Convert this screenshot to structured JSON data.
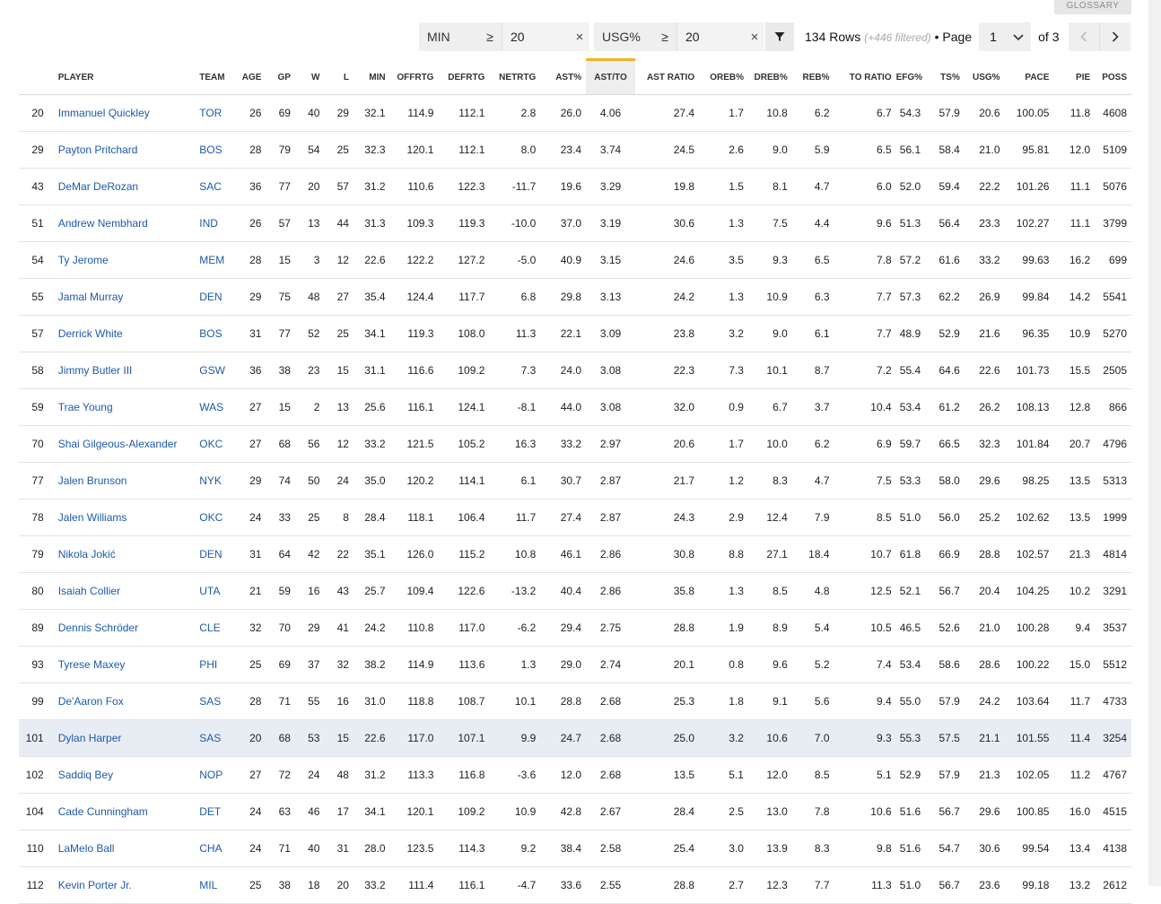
{
  "glossary_label": "GLOSSARY",
  "filters": [
    {
      "stat": "MIN",
      "op": "≥",
      "value": "20"
    },
    {
      "stat": "USG%",
      "op": "≥",
      "value": "20"
    }
  ],
  "rows_info": {
    "rows": "134 Rows",
    "filtered": "(+446 filtered)",
    "page_label": "• Page",
    "page": "1",
    "of_pages": "of 3"
  },
  "columns": [
    "",
    "PLAYER",
    "TEAM",
    "AGE",
    "GP",
    "W",
    "L",
    "MIN",
    "OFFRTG",
    "DEFRTG",
    "NETRTG",
    "AST%",
    "AST/TO",
    "AST RATIO",
    "OREB%",
    "DREB%",
    "REB%",
    "TO RATIO",
    "EFG%",
    "TS%",
    "USG%",
    "PACE",
    "PIE",
    "POSS"
  ],
  "rows": [
    [
      "20",
      "Immanuel Quickley",
      "TOR",
      "26",
      "69",
      "40",
      "29",
      "32.1",
      "114.9",
      "112.1",
      "2.8",
      "26.0",
      "4.06",
      "27.4",
      "1.7",
      "10.8",
      "6.2",
      "6.7",
      "54.3",
      "57.9",
      "20.6",
      "100.05",
      "11.8",
      "4608"
    ],
    [
      "29",
      "Payton Pritchard",
      "BOS",
      "28",
      "79",
      "54",
      "25",
      "32.3",
      "120.1",
      "112.1",
      "8.0",
      "23.4",
      "3.74",
      "24.5",
      "2.6",
      "9.0",
      "5.9",
      "6.5",
      "56.1",
      "58.4",
      "21.0",
      "95.81",
      "12.0",
      "5109"
    ],
    [
      "43",
      "DeMar DeRozan",
      "SAC",
      "36",
      "77",
      "20",
      "57",
      "31.2",
      "110.6",
      "122.3",
      "-11.7",
      "19.6",
      "3.29",
      "19.8",
      "1.5",
      "8.1",
      "4.7",
      "6.0",
      "52.0",
      "59.4",
      "22.2",
      "101.26",
      "11.1",
      "5076"
    ],
    [
      "51",
      "Andrew Nembhard",
      "IND",
      "26",
      "57",
      "13",
      "44",
      "31.3",
      "109.3",
      "119.3",
      "-10.0",
      "37.0",
      "3.19",
      "30.6",
      "1.3",
      "7.5",
      "4.4",
      "9.6",
      "51.3",
      "56.4",
      "23.3",
      "102.27",
      "11.1",
      "3799"
    ],
    [
      "54",
      "Ty Jerome",
      "MEM",
      "28",
      "15",
      "3",
      "12",
      "22.6",
      "122.2",
      "127.2",
      "-5.0",
      "40.9",
      "3.15",
      "24.6",
      "3.5",
      "9.3",
      "6.5",
      "7.8",
      "57.2",
      "61.6",
      "33.2",
      "99.63",
      "16.2",
      "699"
    ],
    [
      "55",
      "Jamal Murray",
      "DEN",
      "29",
      "75",
      "48",
      "27",
      "35.4",
      "124.4",
      "117.7",
      "6.8",
      "29.8",
      "3.13",
      "24.2",
      "1.3",
      "10.9",
      "6.3",
      "7.7",
      "57.3",
      "62.2",
      "26.9",
      "99.84",
      "14.2",
      "5541"
    ],
    [
      "57",
      "Derrick White",
      "BOS",
      "31",
      "77",
      "52",
      "25",
      "34.1",
      "119.3",
      "108.0",
      "11.3",
      "22.1",
      "3.09",
      "23.8",
      "3.2",
      "9.0",
      "6.1",
      "7.7",
      "48.9",
      "52.9",
      "21.6",
      "96.35",
      "10.9",
      "5270"
    ],
    [
      "58",
      "Jimmy Butler III",
      "GSW",
      "36",
      "38",
      "23",
      "15",
      "31.1",
      "116.6",
      "109.2",
      "7.3",
      "24.0",
      "3.08",
      "22.3",
      "7.3",
      "10.1",
      "8.7",
      "7.2",
      "55.4",
      "64.6",
      "22.6",
      "101.73",
      "15.5",
      "2505"
    ],
    [
      "59",
      "Trae Young",
      "WAS",
      "27",
      "15",
      "2",
      "13",
      "25.6",
      "116.1",
      "124.1",
      "-8.1",
      "44.0",
      "3.08",
      "32.0",
      "0.9",
      "6.7",
      "3.7",
      "10.4",
      "53.4",
      "61.2",
      "26.2",
      "108.13",
      "12.8",
      "866"
    ],
    [
      "70",
      "Shai Gilgeous-Alexander",
      "OKC",
      "27",
      "68",
      "56",
      "12",
      "33.2",
      "121.5",
      "105.2",
      "16.3",
      "33.2",
      "2.97",
      "20.6",
      "1.7",
      "10.0",
      "6.2",
      "6.9",
      "59.7",
      "66.5",
      "32.3",
      "101.84",
      "20.7",
      "4796"
    ],
    [
      "77",
      "Jalen Brunson",
      "NYK",
      "29",
      "74",
      "50",
      "24",
      "35.0",
      "120.2",
      "114.1",
      "6.1",
      "30.7",
      "2.87",
      "21.7",
      "1.2",
      "8.3",
      "4.7",
      "7.5",
      "53.3",
      "58.0",
      "29.6",
      "98.25",
      "13.5",
      "5313"
    ],
    [
      "78",
      "Jalen Williams",
      "OKC",
      "24",
      "33",
      "25",
      "8",
      "28.4",
      "118.1",
      "106.4",
      "11.7",
      "27.4",
      "2.87",
      "24.3",
      "2.9",
      "12.4",
      "7.9",
      "8.5",
      "51.0",
      "56.0",
      "25.2",
      "102.62",
      "13.5",
      "1999"
    ],
    [
      "79",
      "Nikola Jokić",
      "DEN",
      "31",
      "64",
      "42",
      "22",
      "35.1",
      "126.0",
      "115.2",
      "10.8",
      "46.1",
      "2.86",
      "30.8",
      "8.8",
      "27.1",
      "18.4",
      "10.7",
      "61.8",
      "66.9",
      "28.8",
      "102.57",
      "21.3",
      "4814"
    ],
    [
      "80",
      "Isaiah Collier",
      "UTA",
      "21",
      "59",
      "16",
      "43",
      "25.7",
      "109.4",
      "122.6",
      "-13.2",
      "40.4",
      "2.86",
      "35.8",
      "1.3",
      "8.5",
      "4.8",
      "12.5",
      "52.1",
      "56.7",
      "20.4",
      "104.25",
      "10.2",
      "3291"
    ],
    [
      "89",
      "Dennis Schröder",
      "CLE",
      "32",
      "70",
      "29",
      "41",
      "24.2",
      "110.8",
      "117.0",
      "-6.2",
      "29.4",
      "2.75",
      "28.8",
      "1.9",
      "8.9",
      "5.4",
      "10.5",
      "46.5",
      "52.6",
      "21.0",
      "100.28",
      "9.4",
      "3537"
    ],
    [
      "93",
      "Tyrese Maxey",
      "PHI",
      "25",
      "69",
      "37",
      "32",
      "38.2",
      "114.9",
      "113.6",
      "1.3",
      "29.0",
      "2.74",
      "20.1",
      "0.8",
      "9.6",
      "5.2",
      "7.4",
      "53.4",
      "58.6",
      "28.6",
      "100.22",
      "15.0",
      "5512"
    ],
    [
      "99",
      "De'Aaron Fox",
      "SAS",
      "28",
      "71",
      "55",
      "16",
      "31.0",
      "118.8",
      "108.7",
      "10.1",
      "28.8",
      "2.68",
      "25.3",
      "1.8",
      "9.1",
      "5.6",
      "9.4",
      "55.0",
      "57.9",
      "24.2",
      "103.64",
      "11.7",
      "4733"
    ],
    [
      "101",
      "Dylan Harper",
      "SAS",
      "20",
      "68",
      "53",
      "15",
      "22.6",
      "117.0",
      "107.1",
      "9.9",
      "24.7",
      "2.68",
      "25.0",
      "3.2",
      "10.6",
      "7.0",
      "9.3",
      "55.3",
      "57.5",
      "21.1",
      "101.55",
      "11.4",
      "3254"
    ],
    [
      "102",
      "Saddiq Bey",
      "NOP",
      "27",
      "72",
      "24",
      "48",
      "31.2",
      "113.3",
      "116.8",
      "-3.6",
      "12.0",
      "2.68",
      "13.5",
      "5.1",
      "12.0",
      "8.5",
      "5.1",
      "52.9",
      "57.9",
      "21.3",
      "102.05",
      "11.2",
      "4767"
    ],
    [
      "104",
      "Cade Cunningham",
      "DET",
      "24",
      "63",
      "46",
      "17",
      "34.1",
      "120.1",
      "109.2",
      "10.9",
      "42.8",
      "2.67",
      "28.4",
      "2.5",
      "13.0",
      "7.8",
      "10.6",
      "51.6",
      "56.7",
      "29.6",
      "100.85",
      "16.0",
      "4515"
    ],
    [
      "110",
      "LaMelo Ball",
      "CHA",
      "24",
      "71",
      "40",
      "31",
      "28.0",
      "123.5",
      "114.3",
      "9.2",
      "38.4",
      "2.58",
      "25.4",
      "3.0",
      "13.9",
      "8.3",
      "9.8",
      "51.6",
      "54.7",
      "30.6",
      "99.54",
      "13.4",
      "4138"
    ],
    [
      "112",
      "Kevin Porter Jr.",
      "MIL",
      "25",
      "38",
      "18",
      "20",
      "33.2",
      "111.4",
      "116.1",
      "-4.7",
      "33.6",
      "2.55",
      "28.8",
      "2.7",
      "12.3",
      "7.7",
      "11.3",
      "51.0",
      "56.7",
      "23.6",
      "99.18",
      "13.2",
      "2612"
    ]
  ],
  "highlight_row_index": 17,
  "sorted_column": "AST/TO",
  "colors": {
    "link": "#1d5aa8",
    "sort_accent": "#f0b429",
    "highlight_row": "#e8edf4"
  },
  "icons": {
    "clear": "close-icon",
    "filter": "funnel-icon",
    "dropdown": "chevron-down-icon",
    "prev": "chevron-left-icon",
    "next": "chevron-right-icon"
  }
}
